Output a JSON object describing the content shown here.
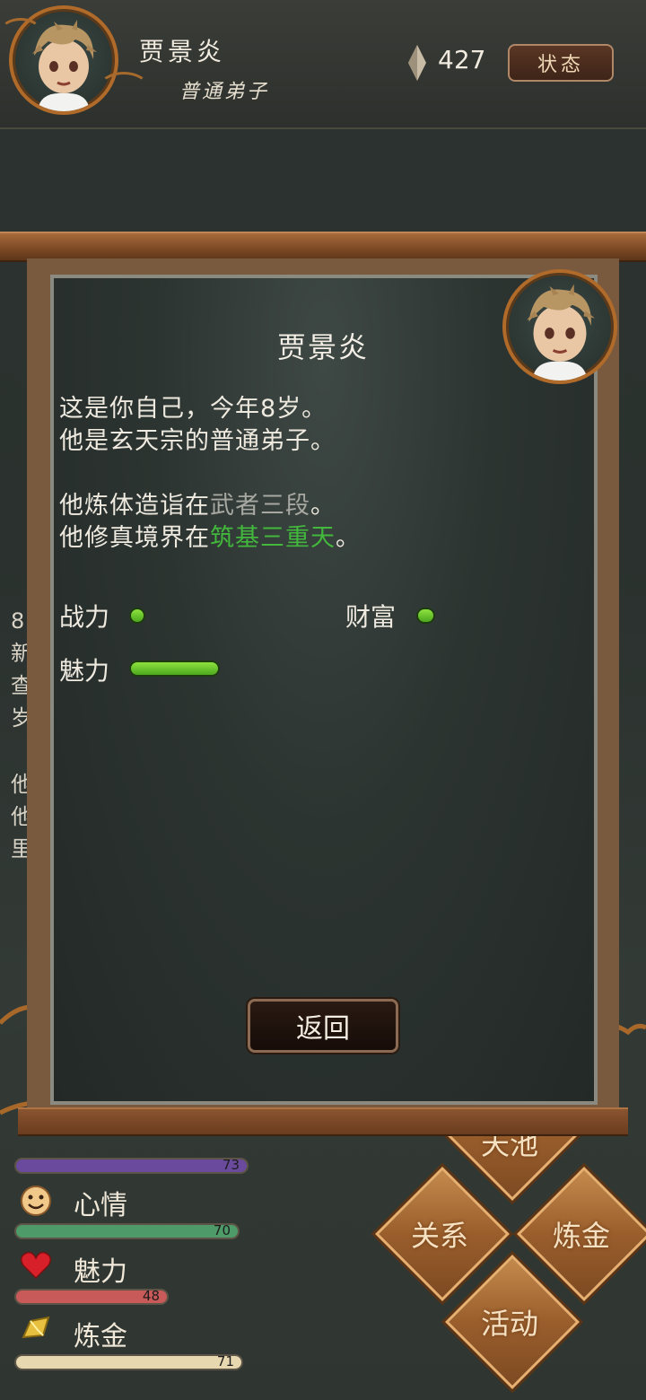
{
  "header": {
    "player_name": "贾景炎",
    "player_rank": "普通弟子",
    "gem_count": "427",
    "status_button": "状态"
  },
  "background_text": [
    "8",
    "新",
    "查",
    "岁",
    "",
    "他",
    "他",
    "里"
  ],
  "bottom_stats": [
    {
      "label": "",
      "value": "73",
      "ratio": 0.73,
      "color": "#6a4a9c",
      "icon": "partially-hidden-icon"
    },
    {
      "label": "心情",
      "value": "70",
      "ratio": 0.7,
      "color": "#4e9a68",
      "icon": "smiley-icon"
    },
    {
      "label": "魅力",
      "value": "48",
      "ratio": 0.48,
      "color": "#c85a5a",
      "icon": "heart-icon"
    },
    {
      "label": "炼金",
      "value": "71",
      "ratio": 0.71,
      "color": "#e8d8b0",
      "icon": "gold-ingot-icon"
    }
  ],
  "action_buttons": {
    "top": "天池",
    "relations": "关系",
    "alchemy": "炼金",
    "activity": "活动"
  },
  "panel": {
    "title": "贾景炎",
    "line1": "这是你自己，今年8岁。",
    "line2": "他是玄天宗的普通弟子。",
    "line3_prefix": "他炼体造诣在",
    "line3_highlight": "武者三段",
    "line3_suffix": "。",
    "line4_prefix": "他修真境界在",
    "line4_highlight": "筑基三重天",
    "line4_suffix": "。",
    "attributes": [
      {
        "label": "战力",
        "level": 0.08
      },
      {
        "label": "财富",
        "level": 0.08
      },
      {
        "label": "魅力",
        "level": 0.42
      }
    ],
    "return_button": "返回"
  },
  "colors": {
    "highlight_green": "#42b83c",
    "highlight_grey": "#a8a8a2",
    "accent_brown": "#b06a2a"
  }
}
